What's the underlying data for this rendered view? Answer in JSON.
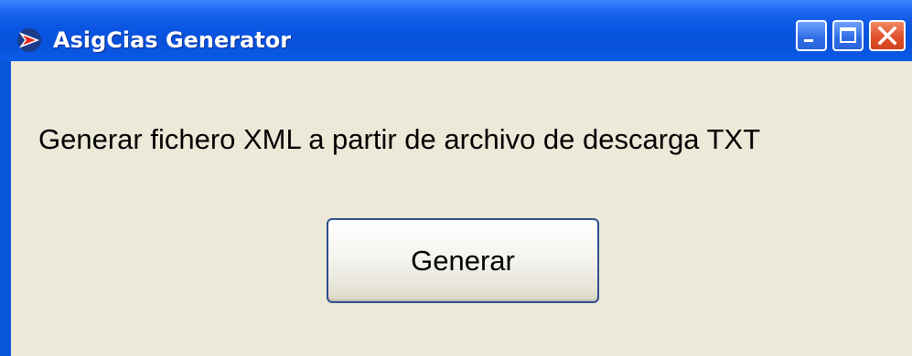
{
  "window": {
    "title": "AsigCias Generator",
    "icon": "app-red-arrow-icon",
    "controls": {
      "minimize": "minimize-icon",
      "maximize": "maximize-icon",
      "close": "close-icon"
    }
  },
  "main": {
    "message": "Generar fichero XML a partir de archivo de descarga TXT",
    "generate_button_label": "Generar"
  },
  "colors": {
    "titlebar": "#0a56e2",
    "client_background": "#ece9d8",
    "close_button": "#e2502a"
  }
}
